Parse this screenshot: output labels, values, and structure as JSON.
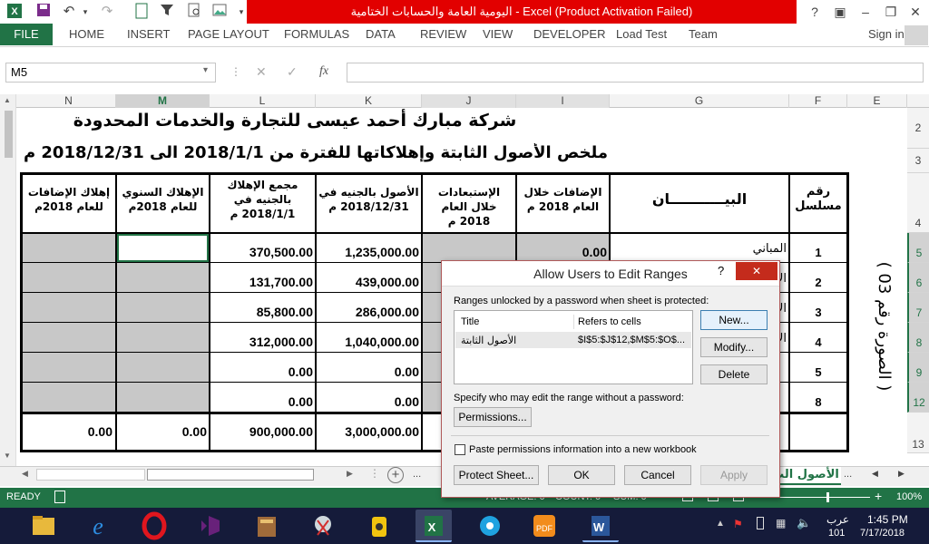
{
  "title": "اليومية العامة والحسابات الختامية  -  Excel (Product Activation Failed)",
  "ribbon_tabs": [
    "FILE",
    "HOME",
    "INSERT",
    "PAGE LAYOUT",
    "FORMULAS",
    "DATA",
    "REVIEW",
    "VIEW",
    "DEVELOPER",
    "Load Test",
    "Team"
  ],
  "sign_in": "Sign in",
  "name_box": "M5",
  "fx": "fx",
  "columns": [
    "N",
    "M",
    "L",
    "K",
    "J",
    "I",
    "G",
    "F",
    "E"
  ],
  "rows": [
    "2",
    "3",
    "4",
    "5",
    "6",
    "7",
    "8",
    "9",
    "12",
    "13"
  ],
  "company": "شركة مبارك أحمد عيسى للتجارة والخدمات المحدودة",
  "summary": "ملخص الأصول الثابتة وإهلاكاتها  للفترة من 2018/1/1 الى 2018/12/31 م",
  "headers": {
    "serial": "رقم مسلسل",
    "desc": "البيـــــــــــان",
    "additions": "الإضافات خلال العام 2018 م",
    "exclusions": "الإستبعادات خلال العام 2018 م",
    "assets": "الأصول بالجنيه في 2018/12/31 م",
    "accum": "مجمع الإهلاك بالجنيه في 2018/1/1 م",
    "annual": "الإهلاك السنوي للعام 2018م",
    "add_dep": "إهلاك الإضافات للعام 2018م"
  },
  "table_rows": [
    {
      "serial": "1",
      "desc": "المباني",
      "additions": "0.00",
      "assets": "1,235,000.00",
      "accum": "370,500.00"
    },
    {
      "serial": "2",
      "desc": "الآ",
      "additions": "",
      "assets": "439,000.00",
      "accum": "131,700.00"
    },
    {
      "serial": "3",
      "desc": "الآ",
      "additions": "",
      "assets": "286,000.00",
      "accum": "85,800.00"
    },
    {
      "serial": "4",
      "desc": "الأ",
      "additions": "",
      "assets": "1,040,000.00",
      "accum": "312,000.00"
    },
    {
      "serial": "5",
      "desc": "",
      "additions": "",
      "assets": "0.00",
      "accum": "0.00"
    },
    {
      "serial": "8",
      "desc": "",
      "additions": "",
      "assets": "0.00",
      "accum": "0.00"
    }
  ],
  "totals": {
    "add_dep": "0.00",
    "annual": "0.00",
    "accum": "900,000.00",
    "assets": "3,000,000.00"
  },
  "vertical_label": "( الصورة رقم 03 )",
  "sheet_tab": "الأصول الث",
  "sheet_more": "...",
  "status": {
    "ready": "READY",
    "avg": "AVERAGE: 0",
    "count": "COUNT: 0",
    "sum": "SUM: 0",
    "zoom": "100%",
    "zoom_pct": 100
  },
  "dialog": {
    "title": "Allow Users to Edit Ranges",
    "help": "?",
    "close": "✕",
    "unlocked_label": "Ranges unlocked by a password when sheet is protected:",
    "col_title": "Title",
    "col_refers": "Refers to cells",
    "range_title": "الأصول الثابتة",
    "range_refers": "$I$5:$J$12,$M$5:$O$...",
    "new": "New...",
    "modify": "Modify...",
    "delete": "Delete",
    "specify_label": "Specify who may edit the range without a password:",
    "permissions": "Permissions...",
    "paste_label": "Paste permissions information into a new workbook",
    "protect": "Protect Sheet...",
    "ok": "OK",
    "cancel": "Cancel",
    "apply": "Apply"
  },
  "taskbar": {
    "lang": "عرب",
    "lang_code": "101",
    "time": "1:45 PM",
    "date": "7/17/2018"
  },
  "colors": {
    "excel_green": "#217346",
    "title_red": "#e20000",
    "dialog_close": "#c42b1c"
  }
}
